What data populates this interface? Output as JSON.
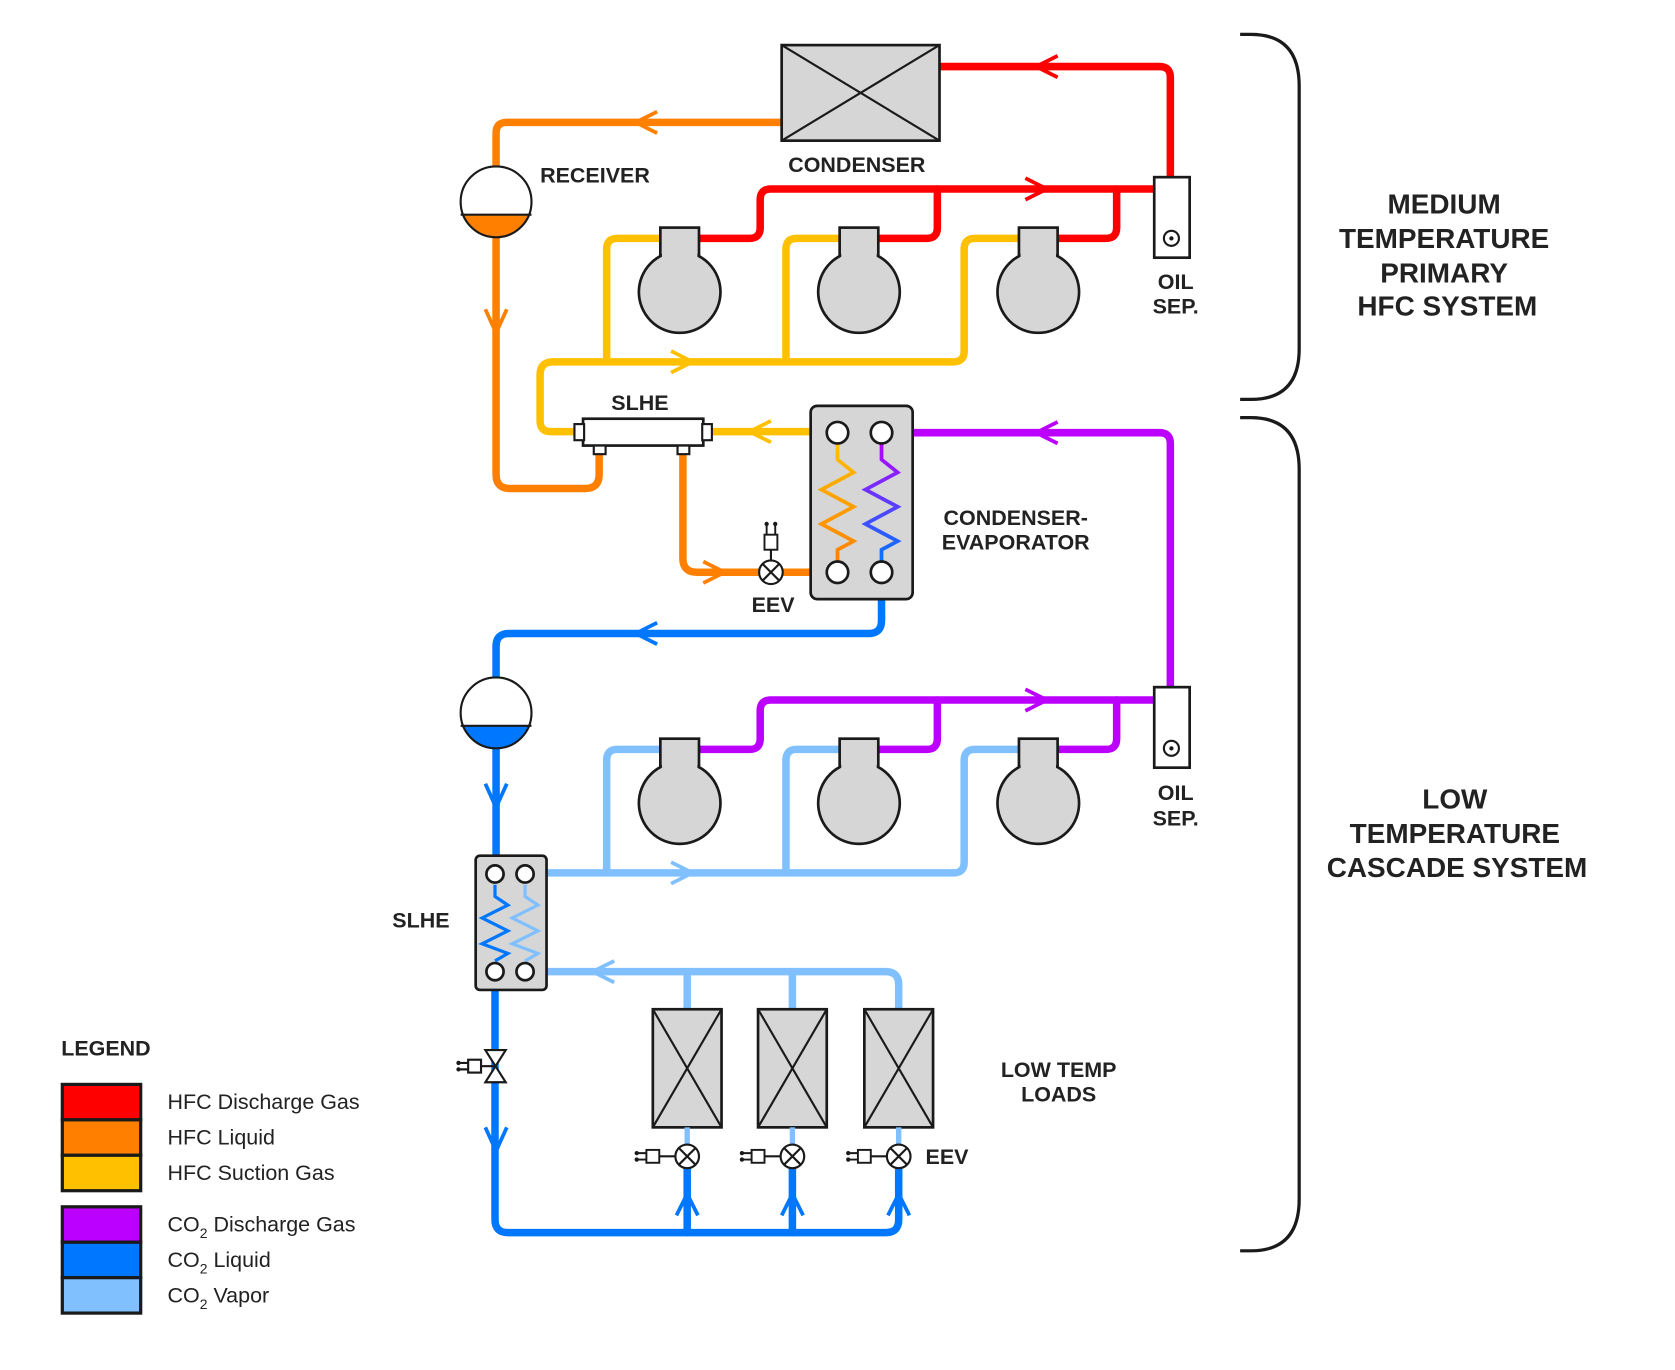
{
  "colors": {
    "hfc_discharge": "#ff0000",
    "hfc_liquid": "#ff8000",
    "hfc_suction": "#ffc000",
    "co2_discharge": "#bb00ff",
    "co2_liquid": "#0077ff",
    "co2_vapor": "#80c0ff",
    "equipment_fill": "#d6d6d6"
  },
  "labels": {
    "condenser": "CONDENSER",
    "receiver": "RECEIVER",
    "oil_sep_1": [
      "OIL",
      "SEP."
    ],
    "oil_sep_2": [
      "OIL",
      "SEP."
    ],
    "slhe_top": "SLHE",
    "slhe_bottom": "SLHE",
    "condenser_evaporator": [
      "CONDENSER-",
      "EVAPORATOR"
    ],
    "eev_top": "EEV",
    "eev_loads": "EEV",
    "low_temp_loads": [
      "LOW TEMP",
      "LOADS"
    ]
  },
  "systems": {
    "medium": [
      "MEDIUM",
      "TEMPERATURE",
      "PRIMARY",
      "HFC SYSTEM"
    ],
    "low": [
      "LOW",
      "TEMPERATURE",
      "CASCADE SYSTEM"
    ]
  },
  "legend": {
    "title": "LEGEND",
    "items": [
      {
        "prefix": "HFC Discharge Gas",
        "sub": "",
        "rest": "",
        "color": "#ff0000"
      },
      {
        "prefix": "HFC Liquid",
        "sub": "",
        "rest": "",
        "color": "#ff8000"
      },
      {
        "prefix": "HFC Suction Gas",
        "sub": "",
        "rest": "",
        "color": "#ffc000"
      },
      {
        "prefix": "CO",
        "sub": "2",
        "rest": " Discharge Gas",
        "color": "#bb00ff"
      },
      {
        "prefix": "CO",
        "sub": "2",
        "rest": " Liquid",
        "color": "#0077ff"
      },
      {
        "prefix": "CO",
        "sub": "2",
        "rest": " Vapor",
        "color": "#80c0ff"
      }
    ]
  }
}
